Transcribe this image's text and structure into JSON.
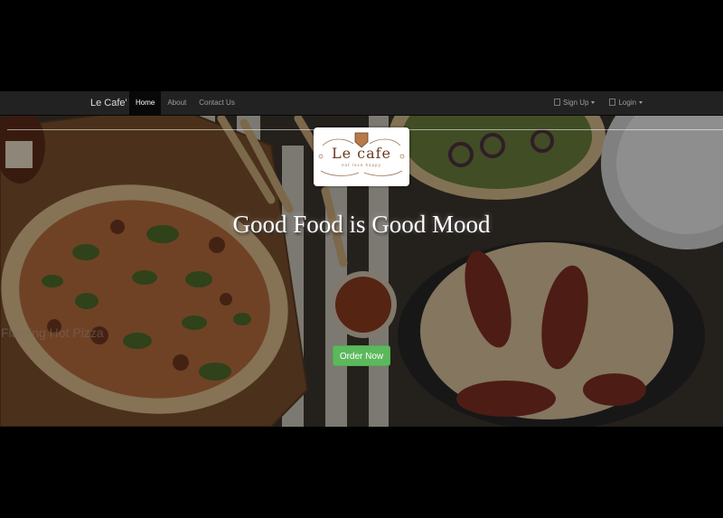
{
  "navbar": {
    "brand": "Le Cafe'",
    "links": [
      {
        "label": "Home",
        "active": true
      },
      {
        "label": "About",
        "active": false
      },
      {
        "label": "Contact Us",
        "active": false
      }
    ],
    "right_links": [
      {
        "label": "Sign Up",
        "icon": "user-icon"
      },
      {
        "label": "Login",
        "icon": "login-icon"
      }
    ]
  },
  "logo": {
    "name": "Le cafe",
    "tagline": "eat love happy"
  },
  "hero": {
    "headline": "Good Food is Good Mood",
    "order_button": "Order Now",
    "ghost_text": "Flaming Hot Pizza"
  },
  "colors": {
    "navbar_bg": "#222222",
    "active_link_bg": "#080808",
    "button_green": "#5cb85c",
    "logo_brown": "#6a3b21"
  }
}
